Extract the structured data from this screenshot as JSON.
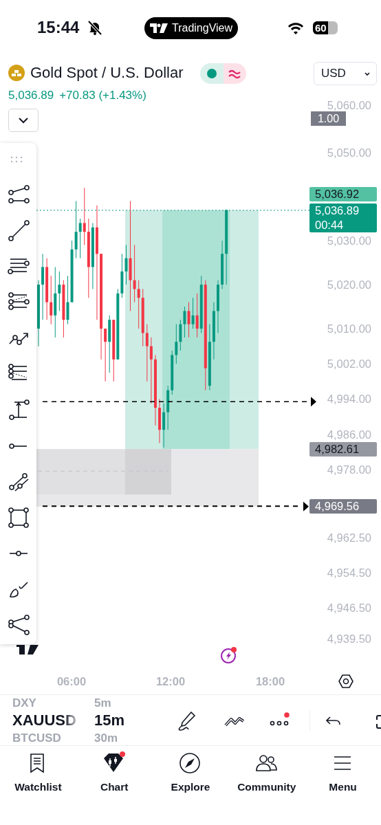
{
  "status_bar": {
    "time": "15:44",
    "app_name": "TradingView",
    "battery": "60"
  },
  "symbol": {
    "title": "Gold Spot / U.S. Dollar",
    "price": "5,036.89",
    "change": "+70.83 (+1.43%)",
    "currency": "USD"
  },
  "chart": {
    "scale_badge": "1.00",
    "price_axis": [
      "5,060.00",
      "5,050.00",
      "5,030.00",
      "5,020.00",
      "5,010.00",
      "5,002.00",
      "4,994.00",
      "4,986.00",
      "4,978.00",
      "4,962.50",
      "4,954.50",
      "4,946.50",
      "4,939.50"
    ],
    "price_badges": [
      {
        "kind": "ask",
        "lines": [
          "5,036.92"
        ]
      },
      {
        "kind": "last",
        "lines": [
          "5,036.89",
          "00:44"
        ]
      },
      {
        "kind": "level",
        "lines": [
          "4,982.61"
        ]
      },
      {
        "kind": "alert",
        "lines": [
          "4,969.56"
        ]
      }
    ],
    "time_axis": [
      "06:00",
      "12:00",
      "18:00"
    ]
  },
  "picker": {
    "symbols": [
      {
        "label": "DXY",
        "selected": false
      },
      {
        "label": "XAUUSD",
        "selected": true
      },
      {
        "label": "BTCUSD",
        "selected": false
      }
    ],
    "intervals": [
      {
        "label": "5m",
        "selected": false
      },
      {
        "label": "15m",
        "selected": true
      },
      {
        "label": "30m",
        "selected": false
      }
    ]
  },
  "toolbar": {
    "more_notification": true
  },
  "nav": [
    {
      "label": "Watchlist",
      "selected": false,
      "notification": false
    },
    {
      "label": "Chart",
      "selected": true,
      "notification": true
    },
    {
      "label": "Explore",
      "selected": false,
      "notification": false
    },
    {
      "label": "Community",
      "selected": false,
      "notification": false
    },
    {
      "label": "Menu",
      "selected": false,
      "notification": false
    }
  ]
}
